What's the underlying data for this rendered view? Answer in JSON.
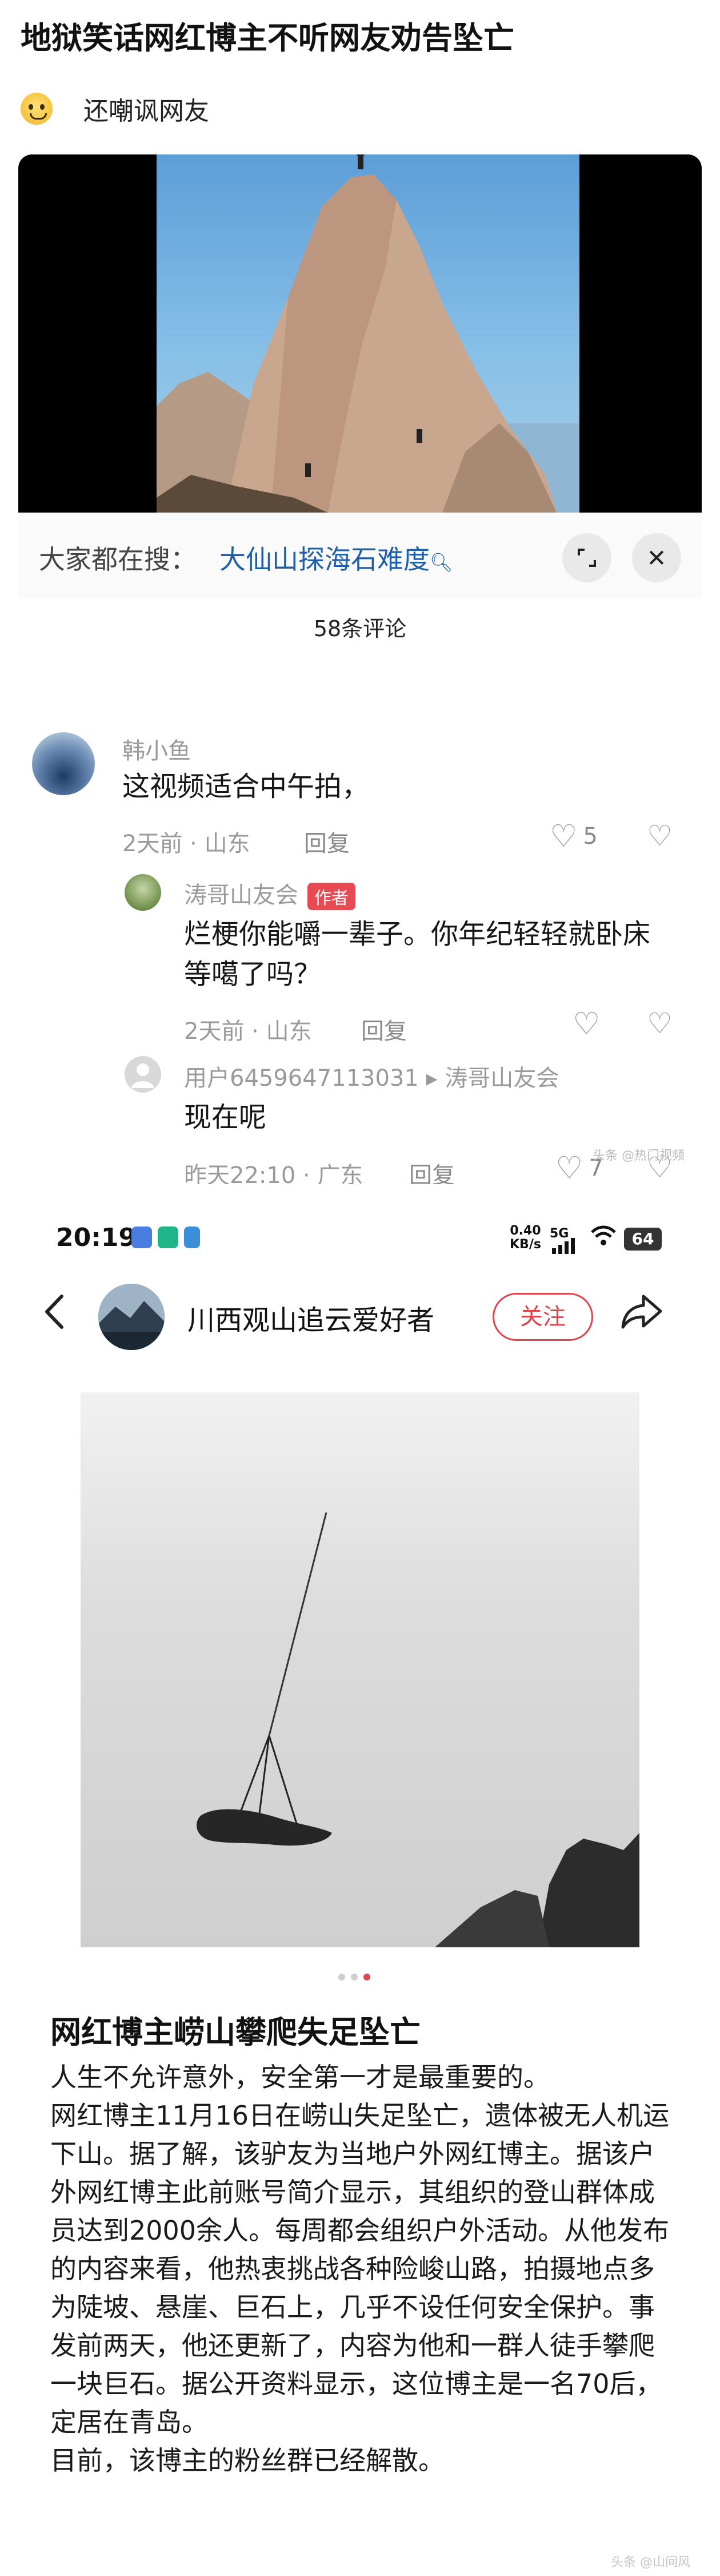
{
  "post": {
    "title": "地狱笑话网红博主不听网友劝告坠亡",
    "subtitle": "还嘲讽网友",
    "subtitle_icon": "worried-face-emoji"
  },
  "shot1": {
    "search_prefix": "大家都在搜：",
    "search_term": "大仙山探海石难度",
    "search_icon": "search-icon",
    "collapse_icon": "collapse-icon",
    "close_icon": "close-icon",
    "comment_count": "58条评论",
    "comments": [
      {
        "name": "韩小鱼",
        "text": "这视频适合中午拍，",
        "time": "2天前",
        "location": "山东",
        "reply": "回复",
        "likes": "5"
      },
      {
        "name": "涛哥山友会",
        "badge": "作者",
        "text_line1": "烂梗你能嚼一辈子。你年纪轻轻就卧床",
        "text_line2": "等噶了吗？",
        "time": "2天前",
        "location": "山东",
        "reply": "回复",
        "likes": ""
      },
      {
        "name": "用户6459647113031",
        "reply_to": "涛哥山友会",
        "text": "现在呢",
        "time": "昨天22:10",
        "location": "广东",
        "reply": "回复",
        "likes": "7"
      }
    ],
    "sep": "·",
    "arrow": "▸",
    "watermark": "头条 @热门视频"
  },
  "shot2": {
    "status": {
      "time": "20:19",
      "speed_top": "0.40",
      "speed_bottom": "KB/s",
      "network": "5G",
      "battery": "64"
    },
    "nav": {
      "author": "川西观山追云爱好者",
      "follow": "关注"
    },
    "carousel": {
      "count": 3,
      "active": 3
    },
    "article": {
      "title": "网红博主崂山攀爬失足坠亡",
      "paragraphs": [
        "人生不允许意外，安全第一才是最重要的。",
        "网红博主11月16日在崂山失足坠亡，遗体被无人机运下山。据了解，该驴友为当地户外网红博主。据该户外网红博主此前账号简介显示，其组织的登山群体成员达到2000余人。每周都会组织户外活动。从他发布的内容来看，他热衷挑战各种险峻山路，拍摄地点多为陡坡、悬崖、巨石上，几乎不设任何安全保护。事发前两天，他还更新了，内容为他和一群人徒手攀爬一块巨石。据公开资料显示，这位博主是一名70后，定居在青岛。",
        "目前，该博主的粉丝群已经解散。"
      ]
    },
    "watermark": "头条 @山间风"
  },
  "colors": {
    "accent_red": "#e0454e",
    "link_blue": "#1f5ea8",
    "meta_gray": "#9a9a9a"
  }
}
